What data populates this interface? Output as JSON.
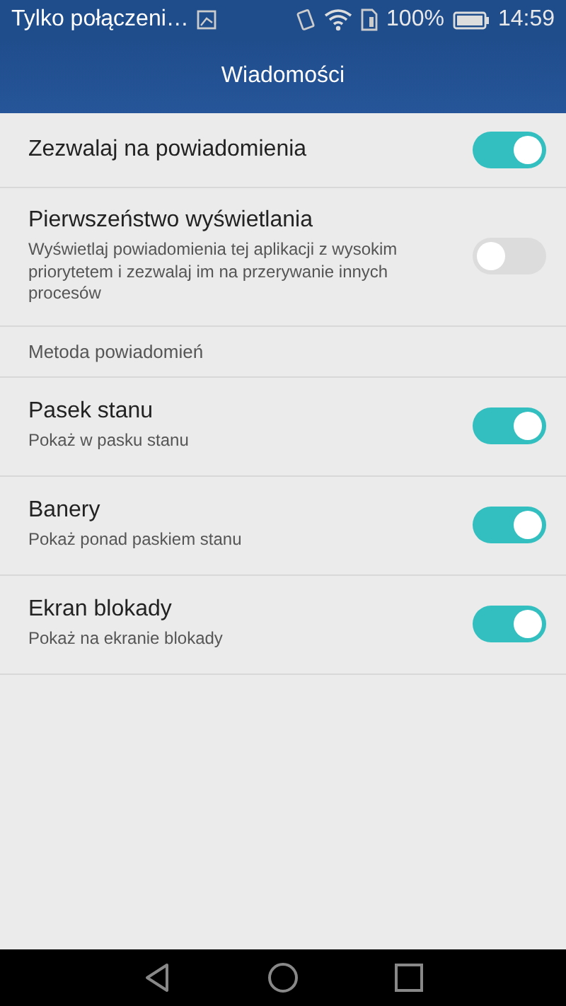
{
  "status_bar": {
    "carrier": "Tylko połączeni…",
    "battery": "100%",
    "time": "14:59"
  },
  "header": {
    "title": "Wiadomości"
  },
  "items": [
    {
      "kind": "toggle",
      "title": "Zezwalaj na powiadomienia",
      "on": true
    },
    {
      "kind": "toggle",
      "title": "Pierwszeństwo wyświetlania",
      "subtitle": "Wyświetlaj powiadomienia tej aplikacji z wysokim priorytetem i zezwalaj im na przerywanie innych procesów",
      "on": false
    },
    {
      "kind": "section",
      "title": "Metoda powiadomień"
    },
    {
      "kind": "toggle",
      "title": "Pasek stanu",
      "subtitle": "Pokaż w pasku stanu",
      "on": true
    },
    {
      "kind": "toggle",
      "title": "Banery",
      "subtitle": "Pokaż ponad paskiem stanu",
      "on": true
    },
    {
      "kind": "toggle",
      "title": "Ekran blokady",
      "subtitle": "Pokaż na ekranie blokady",
      "on": true
    }
  ]
}
